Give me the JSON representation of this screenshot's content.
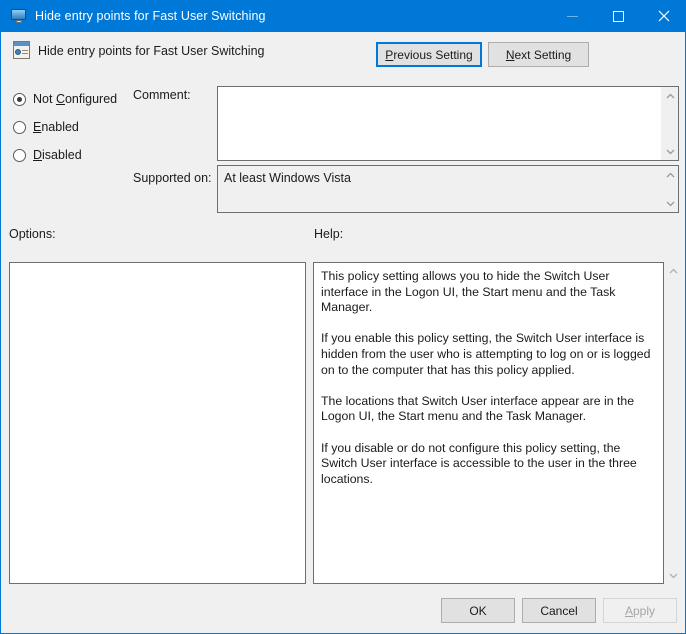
{
  "window": {
    "title": "Hide entry points for Fast User Switching",
    "title_icon": "monitor-icon",
    "controls": {
      "minimize": "minimize-icon",
      "maximize": "maximize-icon",
      "close": "close-icon"
    },
    "accent_color": "#0078d7",
    "background_color": "#f0f0f0"
  },
  "header": {
    "icon": "policy-setting-icon",
    "title": "Hide entry points for Fast User Switching",
    "previous_button": "Previous Setting",
    "previous_button_accel": "P",
    "next_button": "Next Setting",
    "next_button_accel": "N"
  },
  "state": {
    "options": [
      {
        "label": "Not Configured",
        "accel": "C",
        "selected": true
      },
      {
        "label": "Enabled",
        "accel": "E",
        "selected": false
      },
      {
        "label": "Disabled",
        "accel": "D",
        "selected": false
      }
    ]
  },
  "fields": {
    "comment_label": "Comment:",
    "comment_value": "",
    "supported_label": "Supported on:",
    "supported_value": "At least Windows Vista"
  },
  "panes": {
    "options_label": "Options:",
    "options_items": [],
    "help_label": "Help:",
    "help_paragraphs": [
      "This policy setting allows you to hide the Switch User interface in the Logon UI, the Start menu and the Task Manager.",
      "If you enable this policy setting, the Switch User interface is hidden from the user who is attempting to log on or is logged on to the computer that has this policy applied.",
      "The locations that Switch User interface appear are in the Logon UI, the Start menu and the Task Manager.",
      "If you disable or do not configure this policy setting, the Switch User interface is accessible to the user in the three locations."
    ]
  },
  "footer": {
    "ok": "OK",
    "cancel": "Cancel",
    "apply": "Apply",
    "apply_accel": "A",
    "apply_enabled": false
  }
}
